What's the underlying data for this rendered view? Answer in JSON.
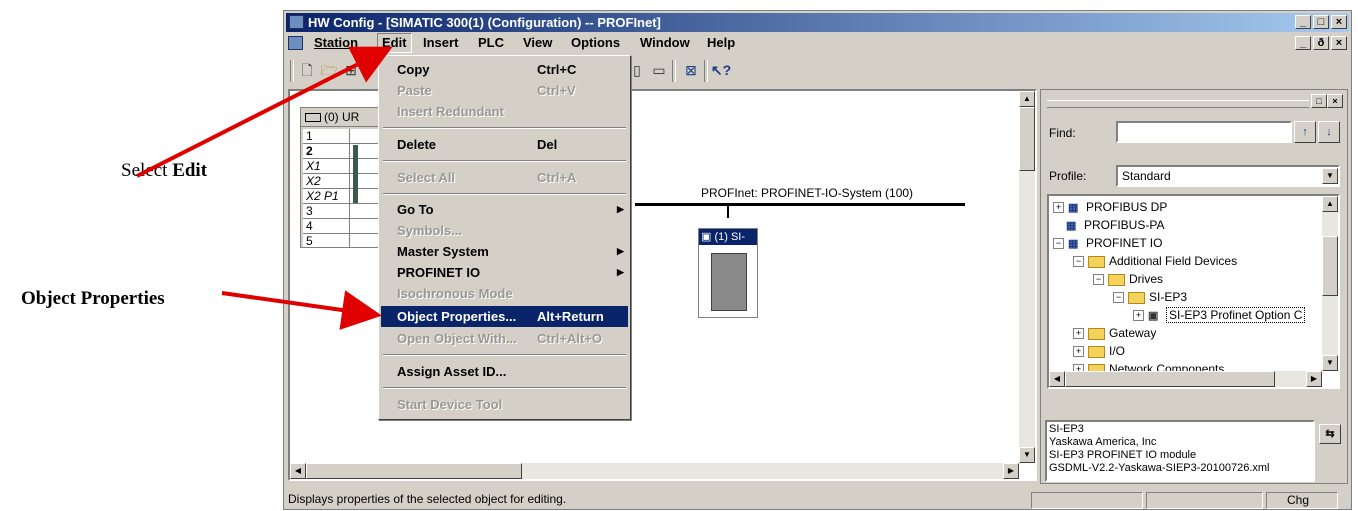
{
  "annotations": {
    "select_prefix": "Select ",
    "select_bold": "Edit",
    "object_properties": "Object Properties"
  },
  "window": {
    "title": "HW Config - [SIMATIC 300(1) (Configuration) -- PROFInet]",
    "controls": [
      "_",
      "□",
      "×"
    ],
    "child_controls": [
      "_",
      "ð",
      "×"
    ]
  },
  "menubar": [
    "Station",
    "Edit",
    "Insert",
    "PLC",
    "View",
    "Options",
    "Window",
    "Help"
  ],
  "edit_menu": {
    "items": [
      {
        "label": "Copy",
        "shortcut": "Ctrl+C",
        "disabled": false
      },
      {
        "label": "Paste",
        "shortcut": "Ctrl+V",
        "disabled": true
      },
      {
        "label": "Insert Redundant",
        "shortcut": "",
        "disabled": true
      },
      {
        "label": "Delete",
        "shortcut": "Del",
        "disabled": false
      },
      {
        "label": "Select All",
        "shortcut": "Ctrl+A",
        "disabled": true
      },
      {
        "label": "Go To",
        "shortcut": "",
        "disabled": false,
        "submenu": true
      },
      {
        "label": "Symbols...",
        "shortcut": "",
        "disabled": true
      },
      {
        "label": "Master System",
        "shortcut": "",
        "disabled": false,
        "submenu": true
      },
      {
        "label": "PROFINET IO",
        "shortcut": "",
        "disabled": false,
        "submenu": true
      },
      {
        "label": "Isochronous Mode",
        "shortcut": "",
        "disabled": true
      },
      {
        "label": "Object Properties...",
        "shortcut": "Alt+Return",
        "disabled": false,
        "highlighted": true
      },
      {
        "label": "Open Object With...",
        "shortcut": "Ctrl+Alt+O",
        "disabled": true
      },
      {
        "label": "Assign Asset ID...",
        "shortcut": "",
        "disabled": false
      },
      {
        "label": "Start Device Tool",
        "shortcut": "",
        "disabled": true
      }
    ]
  },
  "rack": {
    "title": "(0) UR",
    "rows": [
      {
        "slot": "1"
      },
      {
        "slot": "2"
      },
      {
        "slot": "X1"
      },
      {
        "slot": "X2"
      },
      {
        "slot": "X2 P1"
      },
      {
        "slot": "3"
      },
      {
        "slot": "4"
      },
      {
        "slot": "5"
      }
    ]
  },
  "network": {
    "label": "PROFInet: PROFINET-IO-System (100)",
    "device_label": "(1) SI-"
  },
  "catalog": {
    "find_label": "Find:",
    "find_value": "",
    "profile_label": "Profile:",
    "profile_value": "Standard",
    "tree": [
      {
        "label": "PROFIBUS DP",
        "icon": "network-icon",
        "expander": "+"
      },
      {
        "label": "PROFIBUS-PA",
        "icon": "network-icon",
        "expander": ""
      },
      {
        "label": "PROFINET IO",
        "icon": "network-icon",
        "expander": "−"
      },
      {
        "label": "Additional Field Devices",
        "icon": "folder-icon",
        "expander": "−"
      },
      {
        "label": "Drives",
        "icon": "folder-icon",
        "expander": "−"
      },
      {
        "label": "SI-EP3",
        "icon": "folder-icon",
        "expander": "−"
      },
      {
        "label": "SI-EP3 Profinet Option C",
        "icon": "device-icon",
        "expander": "+"
      },
      {
        "label": "Gateway",
        "icon": "folder-icon",
        "expander": "+"
      },
      {
        "label": "I/O",
        "icon": "folder-icon",
        "expander": "+"
      },
      {
        "label": "Network Components",
        "icon": "folder-icon",
        "expander": "+"
      }
    ],
    "info": [
      "SI-EP3",
      "Yaskawa America, Inc",
      "SI-EP3 PROFINET IO module",
      "GSDML-V2.2-Yaskawa-SIEP3-20100726.xml"
    ]
  },
  "statusbar": {
    "message": "Displays properties of the selected object for editing.",
    "chg": "Chg"
  },
  "colors": {
    "title_start": "#0a246a",
    "title_end": "#a6caf0",
    "menu_highlight": "#0a246a",
    "arrow": "#e00000",
    "face": "#d4d0c8"
  }
}
